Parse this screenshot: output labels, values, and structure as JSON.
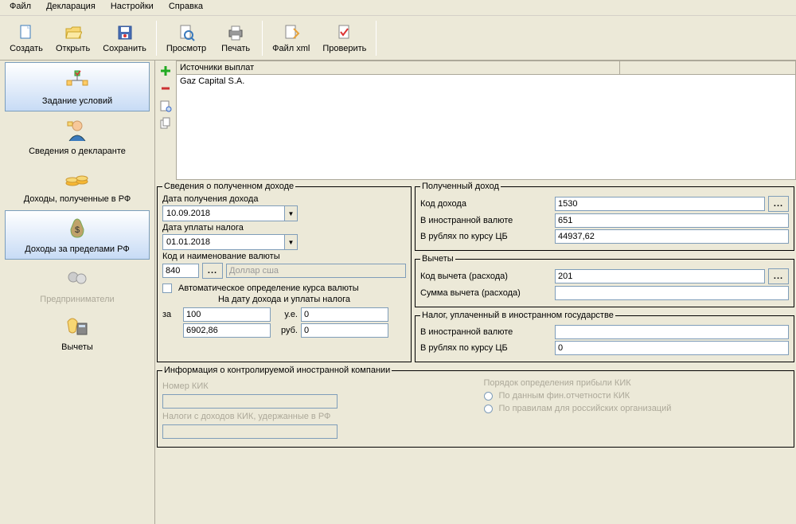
{
  "menu": {
    "file": "Файл",
    "declaration": "Декларация",
    "settings": "Настройки",
    "help": "Справка"
  },
  "toolbar": {
    "create": "Создать",
    "open": "Открыть",
    "save": "Сохранить",
    "preview": "Просмотр",
    "print": "Печать",
    "filexml": "Файл xml",
    "check": "Проверить"
  },
  "nav": {
    "conditions": "Задание условий",
    "declarant": "Сведения о декларанте",
    "income_rf": "Доходы, полученные в РФ",
    "income_foreign": "Доходы за пределами РФ",
    "entrepreneurs": "Предприниматели",
    "deductions": "Вычеты"
  },
  "sources": {
    "header": "Источники выплат",
    "item": "Gaz Capital S.A."
  },
  "income_info": {
    "legend": "Сведения о полученном доходе",
    "date_received_label": "Дата получения дохода",
    "date_received": "10.09.2018",
    "date_tax_label": "Дата уплаты налога",
    "date_tax": "01.01.2018",
    "currency_label": "Код и наименование валюты",
    "currency_code": "840",
    "currency_name": "Доллар сша",
    "auto_rate_label": "Автоматическое определение курса валюты",
    "on_date_label": "На дату дохода и уплаты налога",
    "za": "за",
    "units": "у.е.",
    "rub": "руб.",
    "units_amt": "100",
    "zero1": "0",
    "rub_amt": "6902,86",
    "zero2": "0"
  },
  "received": {
    "legend": "Полученный доход",
    "code_label": "Код дохода",
    "code": "1530",
    "fc_label": "В иностранной валюте",
    "fc": "651",
    "rub_label": "В рублях по курсу ЦБ",
    "rub": "44937,62"
  },
  "deduct": {
    "legend": "Вычеты",
    "code_label": "Код вычета (расхода)",
    "code": "201",
    "sum_label": "Сумма вычета (расхода)",
    "sum": ""
  },
  "foreign_tax": {
    "legend": "Налог, уплаченный в иностранном государстве",
    "fc_label": "В иностранной валюте",
    "fc": "",
    "rub_label": "В рублях по курсу ЦБ",
    "rub": "0"
  },
  "kik": {
    "legend": "Информация о контролируемой иностранной компании",
    "num_label": "Номер КИК",
    "taxes_label": "Налоги с доходов КИК, удержанные в РФ",
    "order_label": "Порядок определения прибыли КИК",
    "opt1": "По данным фин.отчетности КИК",
    "opt2": "По правилам для российских организаций"
  }
}
